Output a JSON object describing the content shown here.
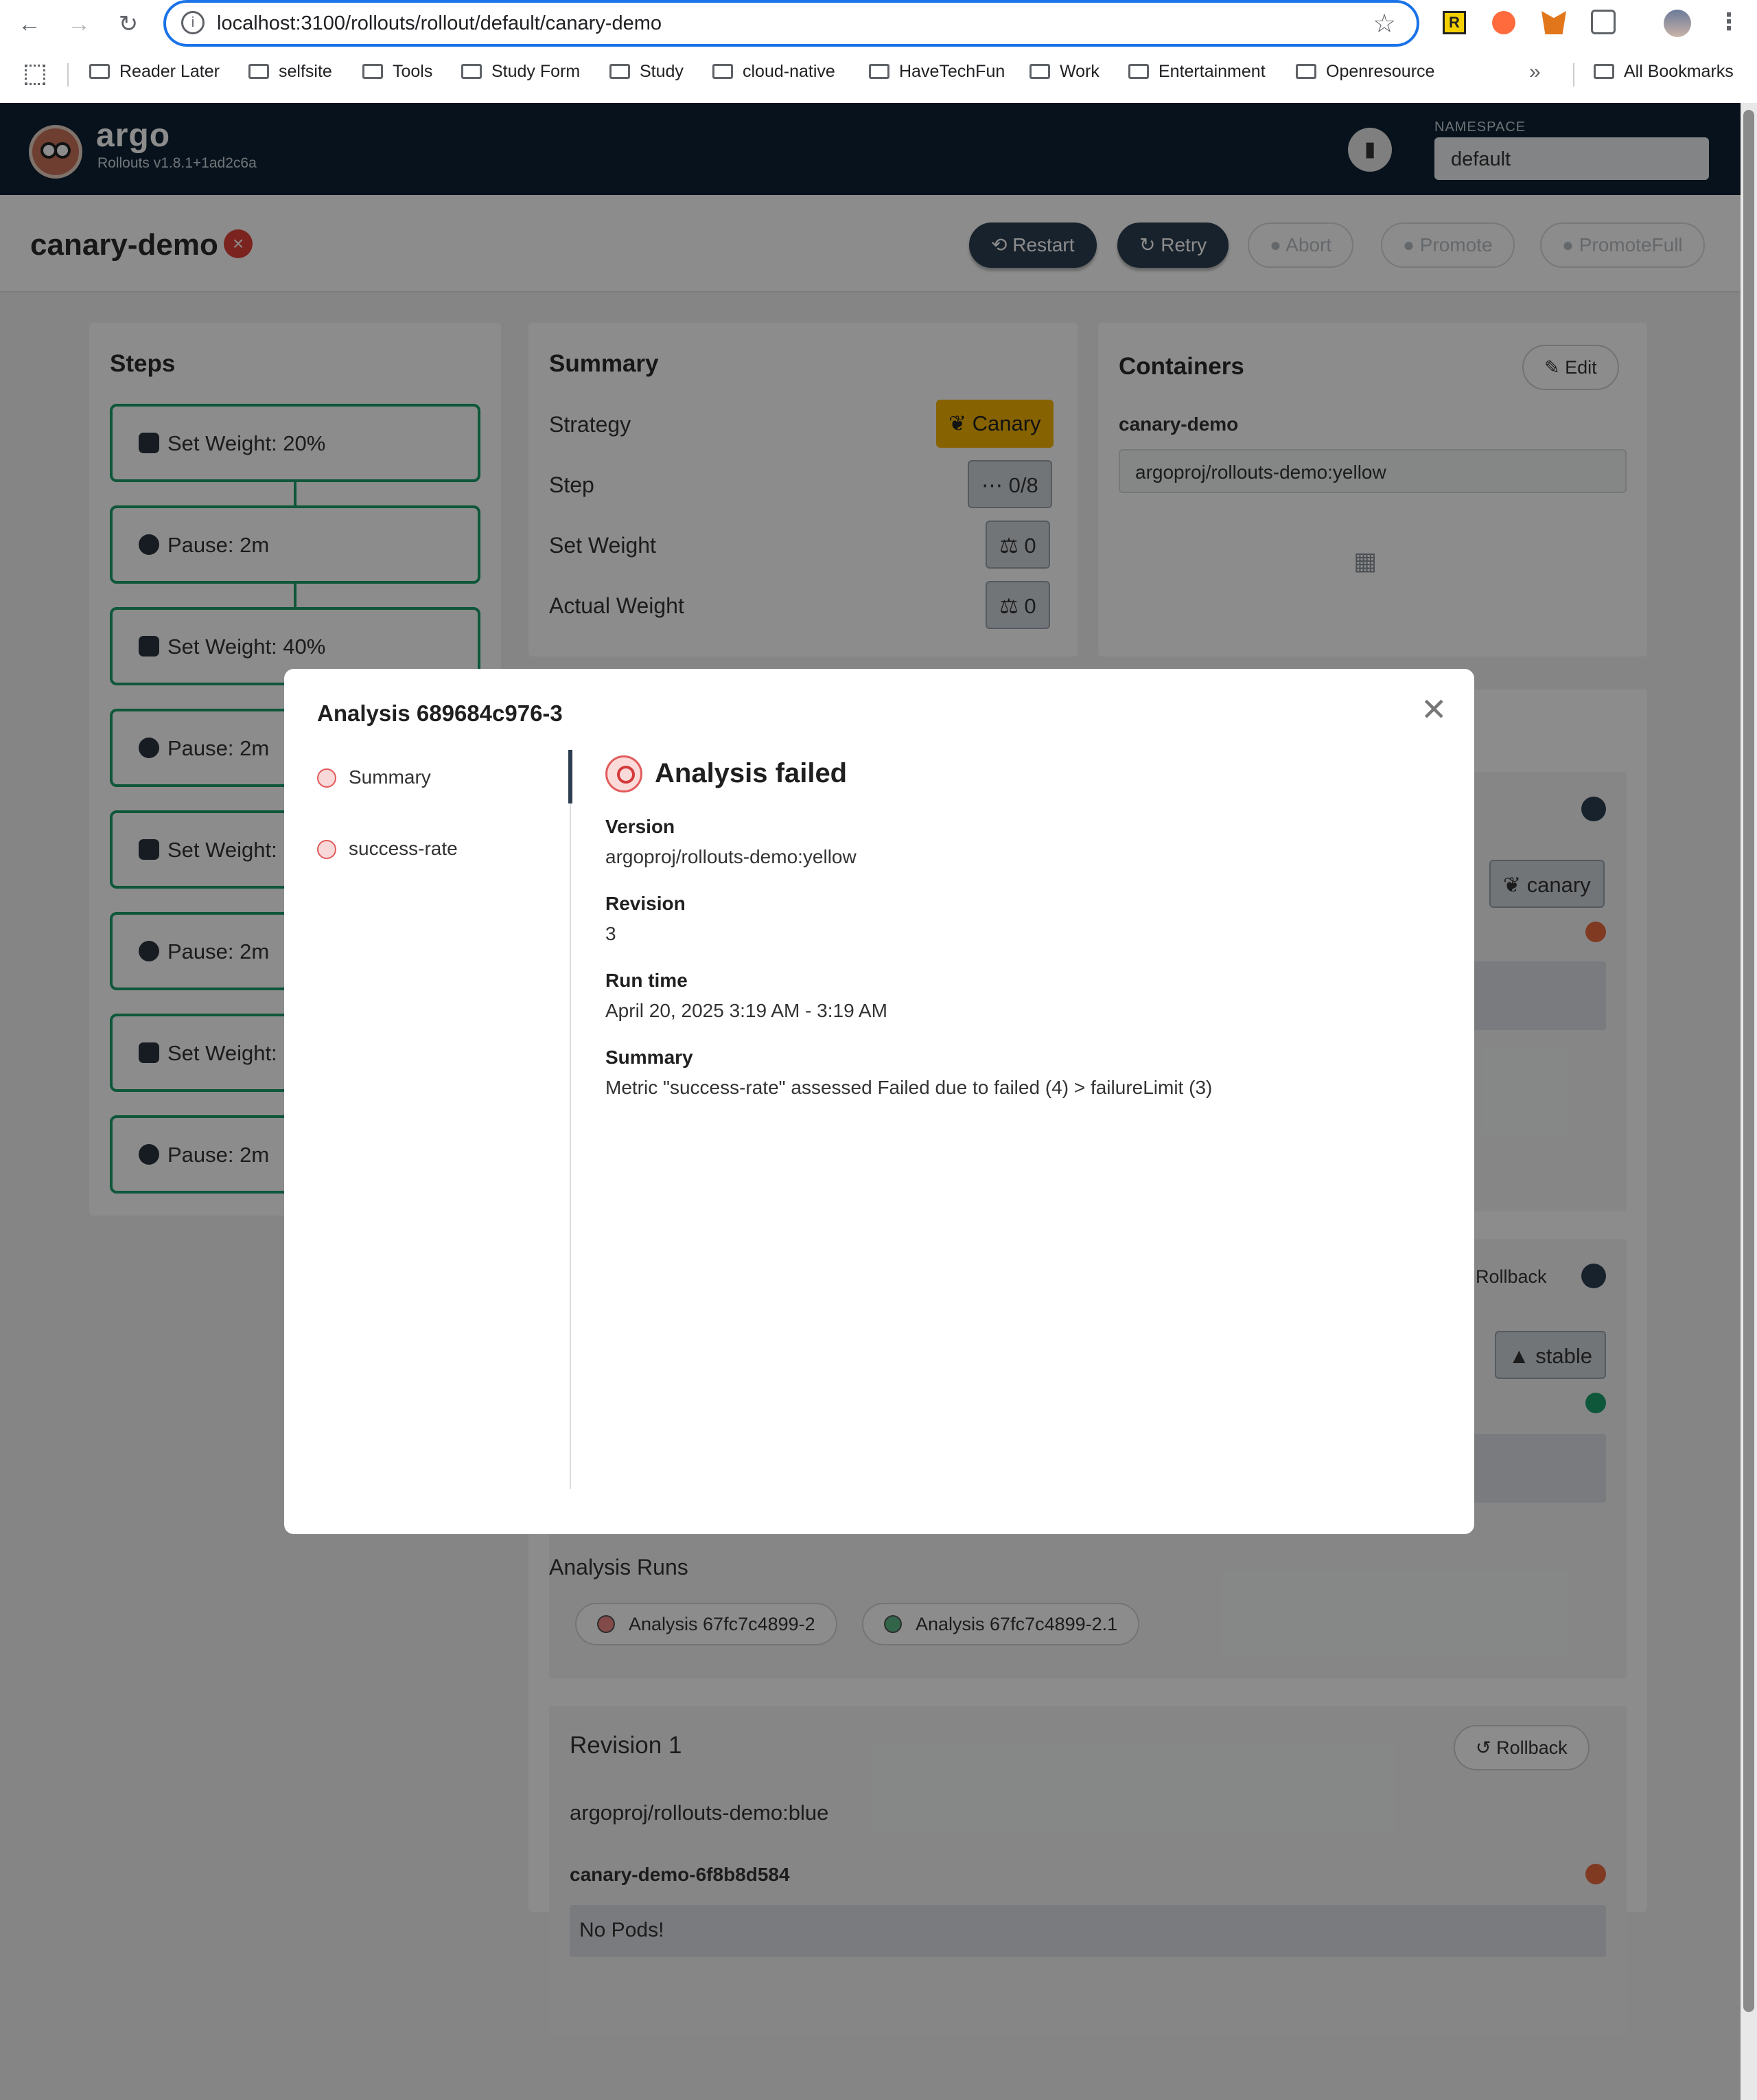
{
  "browser": {
    "url": "localhost:3100/rollouts/rollout/default/canary-demo",
    "bookmarks": [
      "Reader Later",
      "selfsite",
      "Tools",
      "Study Form",
      "Study",
      "cloud-native",
      "HaveTechFun",
      "Work",
      "Entertainment",
      "Openresource"
    ],
    "all_bookmarks": "All Bookmarks"
  },
  "header": {
    "brand": "argo",
    "version": "Rollouts v1.8.1+1ad2c6a",
    "namespace_label": "NAMESPACE",
    "namespace_value": "default"
  },
  "toolbar": {
    "rollout_name": "canary-demo",
    "restart": "Restart",
    "retry": "Retry",
    "abort": "Abort",
    "promote": "Promote",
    "promote_full": "PromoteFull"
  },
  "steps": {
    "title": "Steps",
    "items": [
      "Set Weight: 20%",
      "Pause: 2m",
      "Set Weight: 40%",
      "Pause: 2m",
      "Set Weight: ",
      "Pause: 2m",
      "Set Weight: ",
      "Pause: 2m"
    ]
  },
  "summary": {
    "title": "Summary",
    "strategy_label": "Strategy",
    "strategy_value": "Canary",
    "step_label": "Step",
    "step_value": "0/8",
    "set_weight_label": "Set Weight",
    "set_weight_value": "0",
    "actual_weight_label": "Actual Weight",
    "actual_weight_value": "0"
  },
  "containers": {
    "title": "Containers",
    "edit": "Edit",
    "name": "canary-demo",
    "image": "argoproj/rollouts-demo:yellow"
  },
  "revisions": {
    "canary_badge": "canary",
    "rollback": "Rollback",
    "stable_badge": "stable",
    "analysis_runs_title": "Analysis Runs",
    "analysis_runs": [
      "Analysis 67fc7c4899-2",
      "Analysis 67fc7c4899-2.1"
    ],
    "rev1_title": "Revision 1",
    "rev1_rollback": "Rollback",
    "rev1_image": "argoproj/rollouts-demo:blue",
    "rev1_rs": "canary-demo-6f8b8d584",
    "rev1_pods": "No Pods!"
  },
  "modal": {
    "title": "Analysis 689684c976-3",
    "nav": [
      "Summary",
      "success-rate"
    ],
    "heading": "Analysis failed",
    "version_label": "Version",
    "version_value": "argoproj/rollouts-demo:yellow",
    "revision_label": "Revision",
    "revision_value": "3",
    "runtime_label": "Run time",
    "runtime_value": "April 20, 2025 3:19 AM - 3:19 AM",
    "summary_label": "Summary",
    "summary_value": "Metric \"success-rate\" assessed Failed due to failed (4) > failureLimit (3)"
  },
  "colors": {
    "header_bg": "#0e2233",
    "step_border": "#1a9e6a",
    "canary_gold": "#f5b400",
    "failed_red": "#e25b5b"
  }
}
